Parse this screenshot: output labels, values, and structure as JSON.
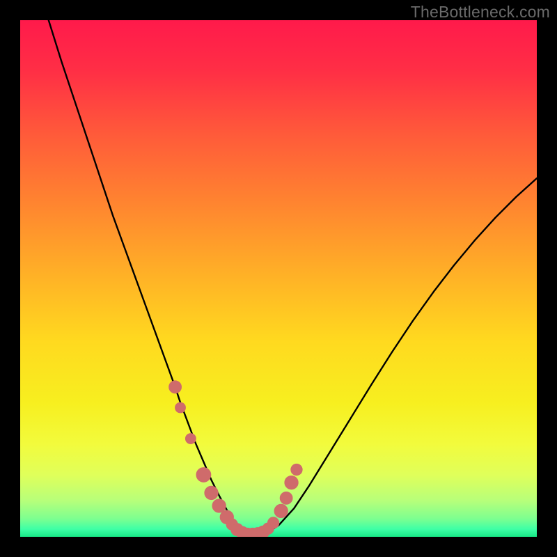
{
  "watermark": "TheBottleneck.com",
  "colors": {
    "page_bg": "#000000",
    "curve_stroke": "#000000",
    "marker_fill": "#cf6b6b",
    "marker_stroke": "#cf6b6b"
  },
  "gradient_stops": [
    {
      "offset": 0.0,
      "color": "#ff1a4b"
    },
    {
      "offset": 0.1,
      "color": "#ff2f45"
    },
    {
      "offset": 0.22,
      "color": "#ff5a3a"
    },
    {
      "offset": 0.35,
      "color": "#ff8330"
    },
    {
      "offset": 0.5,
      "color": "#ffb326"
    },
    {
      "offset": 0.62,
      "color": "#ffd91f"
    },
    {
      "offset": 0.74,
      "color": "#f7ef1f"
    },
    {
      "offset": 0.82,
      "color": "#f2fb3c"
    },
    {
      "offset": 0.88,
      "color": "#e0ff5a"
    },
    {
      "offset": 0.93,
      "color": "#b7ff7a"
    },
    {
      "offset": 0.965,
      "color": "#7dff90"
    },
    {
      "offset": 0.985,
      "color": "#3effa6"
    },
    {
      "offset": 1.0,
      "color": "#17e887"
    }
  ],
  "chart_data": {
    "type": "line",
    "title": "",
    "xlabel": "",
    "ylabel": "",
    "xlim": [
      0,
      100
    ],
    "ylim": [
      0,
      100
    ],
    "series": [
      {
        "name": "bottleneck-curve",
        "x": [
          5.5,
          8,
          10,
          12,
          14,
          16,
          18,
          20,
          22,
          24,
          26,
          28,
          30,
          31,
          32.5,
          34,
          35.5,
          37,
          38.5,
          40,
          41,
          42,
          43,
          44,
          45,
          46,
          48,
          50,
          53,
          56,
          60,
          64,
          68,
          72,
          76,
          80,
          84,
          88,
          92,
          96,
          100
        ],
        "y": [
          100,
          92,
          86,
          80,
          74,
          68,
          62,
          56.5,
          51,
          45.5,
          40,
          34.5,
          29,
          26,
          22,
          18,
          14.5,
          11,
          8,
          5.2,
          3.6,
          2.3,
          1.4,
          0.8,
          0.4,
          0.4,
          0.9,
          2.2,
          5.5,
          10.0,
          16.5,
          23.0,
          29.5,
          35.8,
          41.8,
          47.4,
          52.6,
          57.4,
          61.8,
          65.8,
          69.4
        ]
      }
    ],
    "markers": [
      {
        "x": 30.0,
        "y": 29.0,
        "r": 1.2
      },
      {
        "x": 31.0,
        "y": 25.0,
        "r": 1.0
      },
      {
        "x": 33.0,
        "y": 19.0,
        "r": 1.0
      },
      {
        "x": 35.5,
        "y": 12.0,
        "r": 1.4
      },
      {
        "x": 37.0,
        "y": 8.5,
        "r": 1.3
      },
      {
        "x": 38.5,
        "y": 6.0,
        "r": 1.3
      },
      {
        "x": 40.0,
        "y": 3.8,
        "r": 1.3
      },
      {
        "x": 41.0,
        "y": 2.4,
        "r": 1.1
      },
      {
        "x": 42.0,
        "y": 1.4,
        "r": 1.2
      },
      {
        "x": 43.0,
        "y": 0.8,
        "r": 1.2
      },
      {
        "x": 44.0,
        "y": 0.5,
        "r": 1.2
      },
      {
        "x": 45.0,
        "y": 0.4,
        "r": 1.3
      },
      {
        "x": 46.0,
        "y": 0.5,
        "r": 1.3
      },
      {
        "x": 47.0,
        "y": 0.9,
        "r": 1.2
      },
      {
        "x": 48.0,
        "y": 1.6,
        "r": 1.1
      },
      {
        "x": 49.0,
        "y": 2.7,
        "r": 1.1
      },
      {
        "x": 50.5,
        "y": 5.0,
        "r": 1.3
      },
      {
        "x": 51.5,
        "y": 7.5,
        "r": 1.2
      },
      {
        "x": 52.5,
        "y": 10.5,
        "r": 1.3
      },
      {
        "x": 53.5,
        "y": 13.0,
        "r": 1.1
      }
    ]
  }
}
